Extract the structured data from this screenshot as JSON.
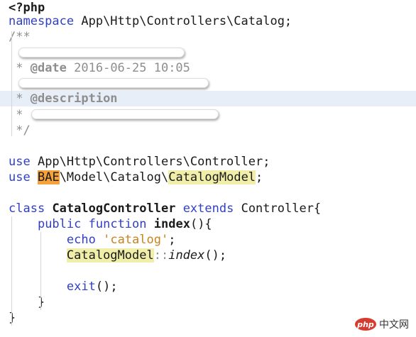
{
  "code": {
    "line1": "<?php",
    "ns_kw": "namespace",
    "ns_val": " App\\Http\\Controllers\\Catalog;",
    "doc_open": "/**",
    "date_star": " * ",
    "date_tag": "@date",
    "date_val": " 2016-06-25 10:05",
    "desc_star": " * ",
    "desc_tag": "@description",
    "star": " *",
    "doc_close": " */",
    "use_kw": "use",
    "use1_val": " App\\Http\\Controllers\\Controller;",
    "use2_pre": " ",
    "bae": "BAE",
    "use2_mid": "\\Model\\Catalog\\",
    "catalog_model": "CatalogModel",
    "semi": ";",
    "class_kw": "class",
    "class_name": "CatalogController",
    "extends_kw": "extends",
    "extends_val": " Controller{",
    "indent1": "    ",
    "public_kw": "public",
    "function_kw": "function",
    "method_name": "index",
    "method_paren": "(){",
    "indent2": "        ",
    "echo_kw": "echo",
    "echo_str": "'catalog'",
    "scope_op": "::",
    "index_call": "index",
    "call_tail": "();",
    "exit_kw": "exit",
    "close_method": "    }",
    "close_class": "}"
  },
  "watermark": {
    "logo": "php",
    "text": "中文网"
  },
  "colors": {
    "keyword": "#2f3fc7",
    "string": "#c7831f",
    "comment": "#8e8e8e",
    "highlight_yellow": "#f1eeaa",
    "highlight_orange": "#f6a23b",
    "current_line": "#e8eef7"
  }
}
